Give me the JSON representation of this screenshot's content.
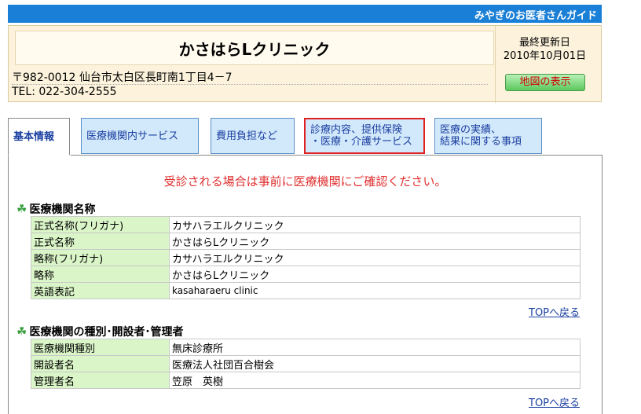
{
  "header": {
    "site_title": "みやぎのお医者さんガイド"
  },
  "clinic": {
    "name": "かさはらLクリニック",
    "updated_label": "最終更新日",
    "updated_date": "2010年10月01日",
    "address": "〒982-0012  仙台市太白区長町南1丁目4－7",
    "tel": "TEL: 022-304-2555",
    "map_button": "地図の表示"
  },
  "tabs": [
    {
      "label": "基本情報"
    },
    {
      "label": "医療機関内サービス"
    },
    {
      "label": "費用負担など"
    },
    {
      "line1": "診療内容、提供保険",
      "line2": "・医療・介護サービス"
    },
    {
      "line1": "医療の実績、",
      "line2": "結果に関する事項"
    }
  ],
  "notice": "受診される場合は事前に医療機関にご確認ください。",
  "sections": [
    {
      "title": "医療機関名称",
      "rows": [
        {
          "key": "正式名称(フリガナ)",
          "value": "カサハラエルクリニック"
        },
        {
          "key": "正式名称",
          "value": "かさはらLクリニック"
        },
        {
          "key": "略称(フリガナ)",
          "value": "カサハラエルクリニック"
        },
        {
          "key": "略称",
          "value": "かさはらLクリニック"
        },
        {
          "key": "英語表記",
          "value": "kasaharaeru clinic"
        }
      ],
      "back_link": "TOPへ戻る"
    },
    {
      "title": "医療機関の種別･開設者･管理者",
      "rows": [
        {
          "key": "医療機関種別",
          "value": "無床診療所"
        },
        {
          "key": "開設者名",
          "value": "医療法人社団百合樹会"
        },
        {
          "key": "管理者名",
          "value": "笠原　英樹"
        }
      ],
      "back_link": "TOPへ戻る"
    }
  ]
}
